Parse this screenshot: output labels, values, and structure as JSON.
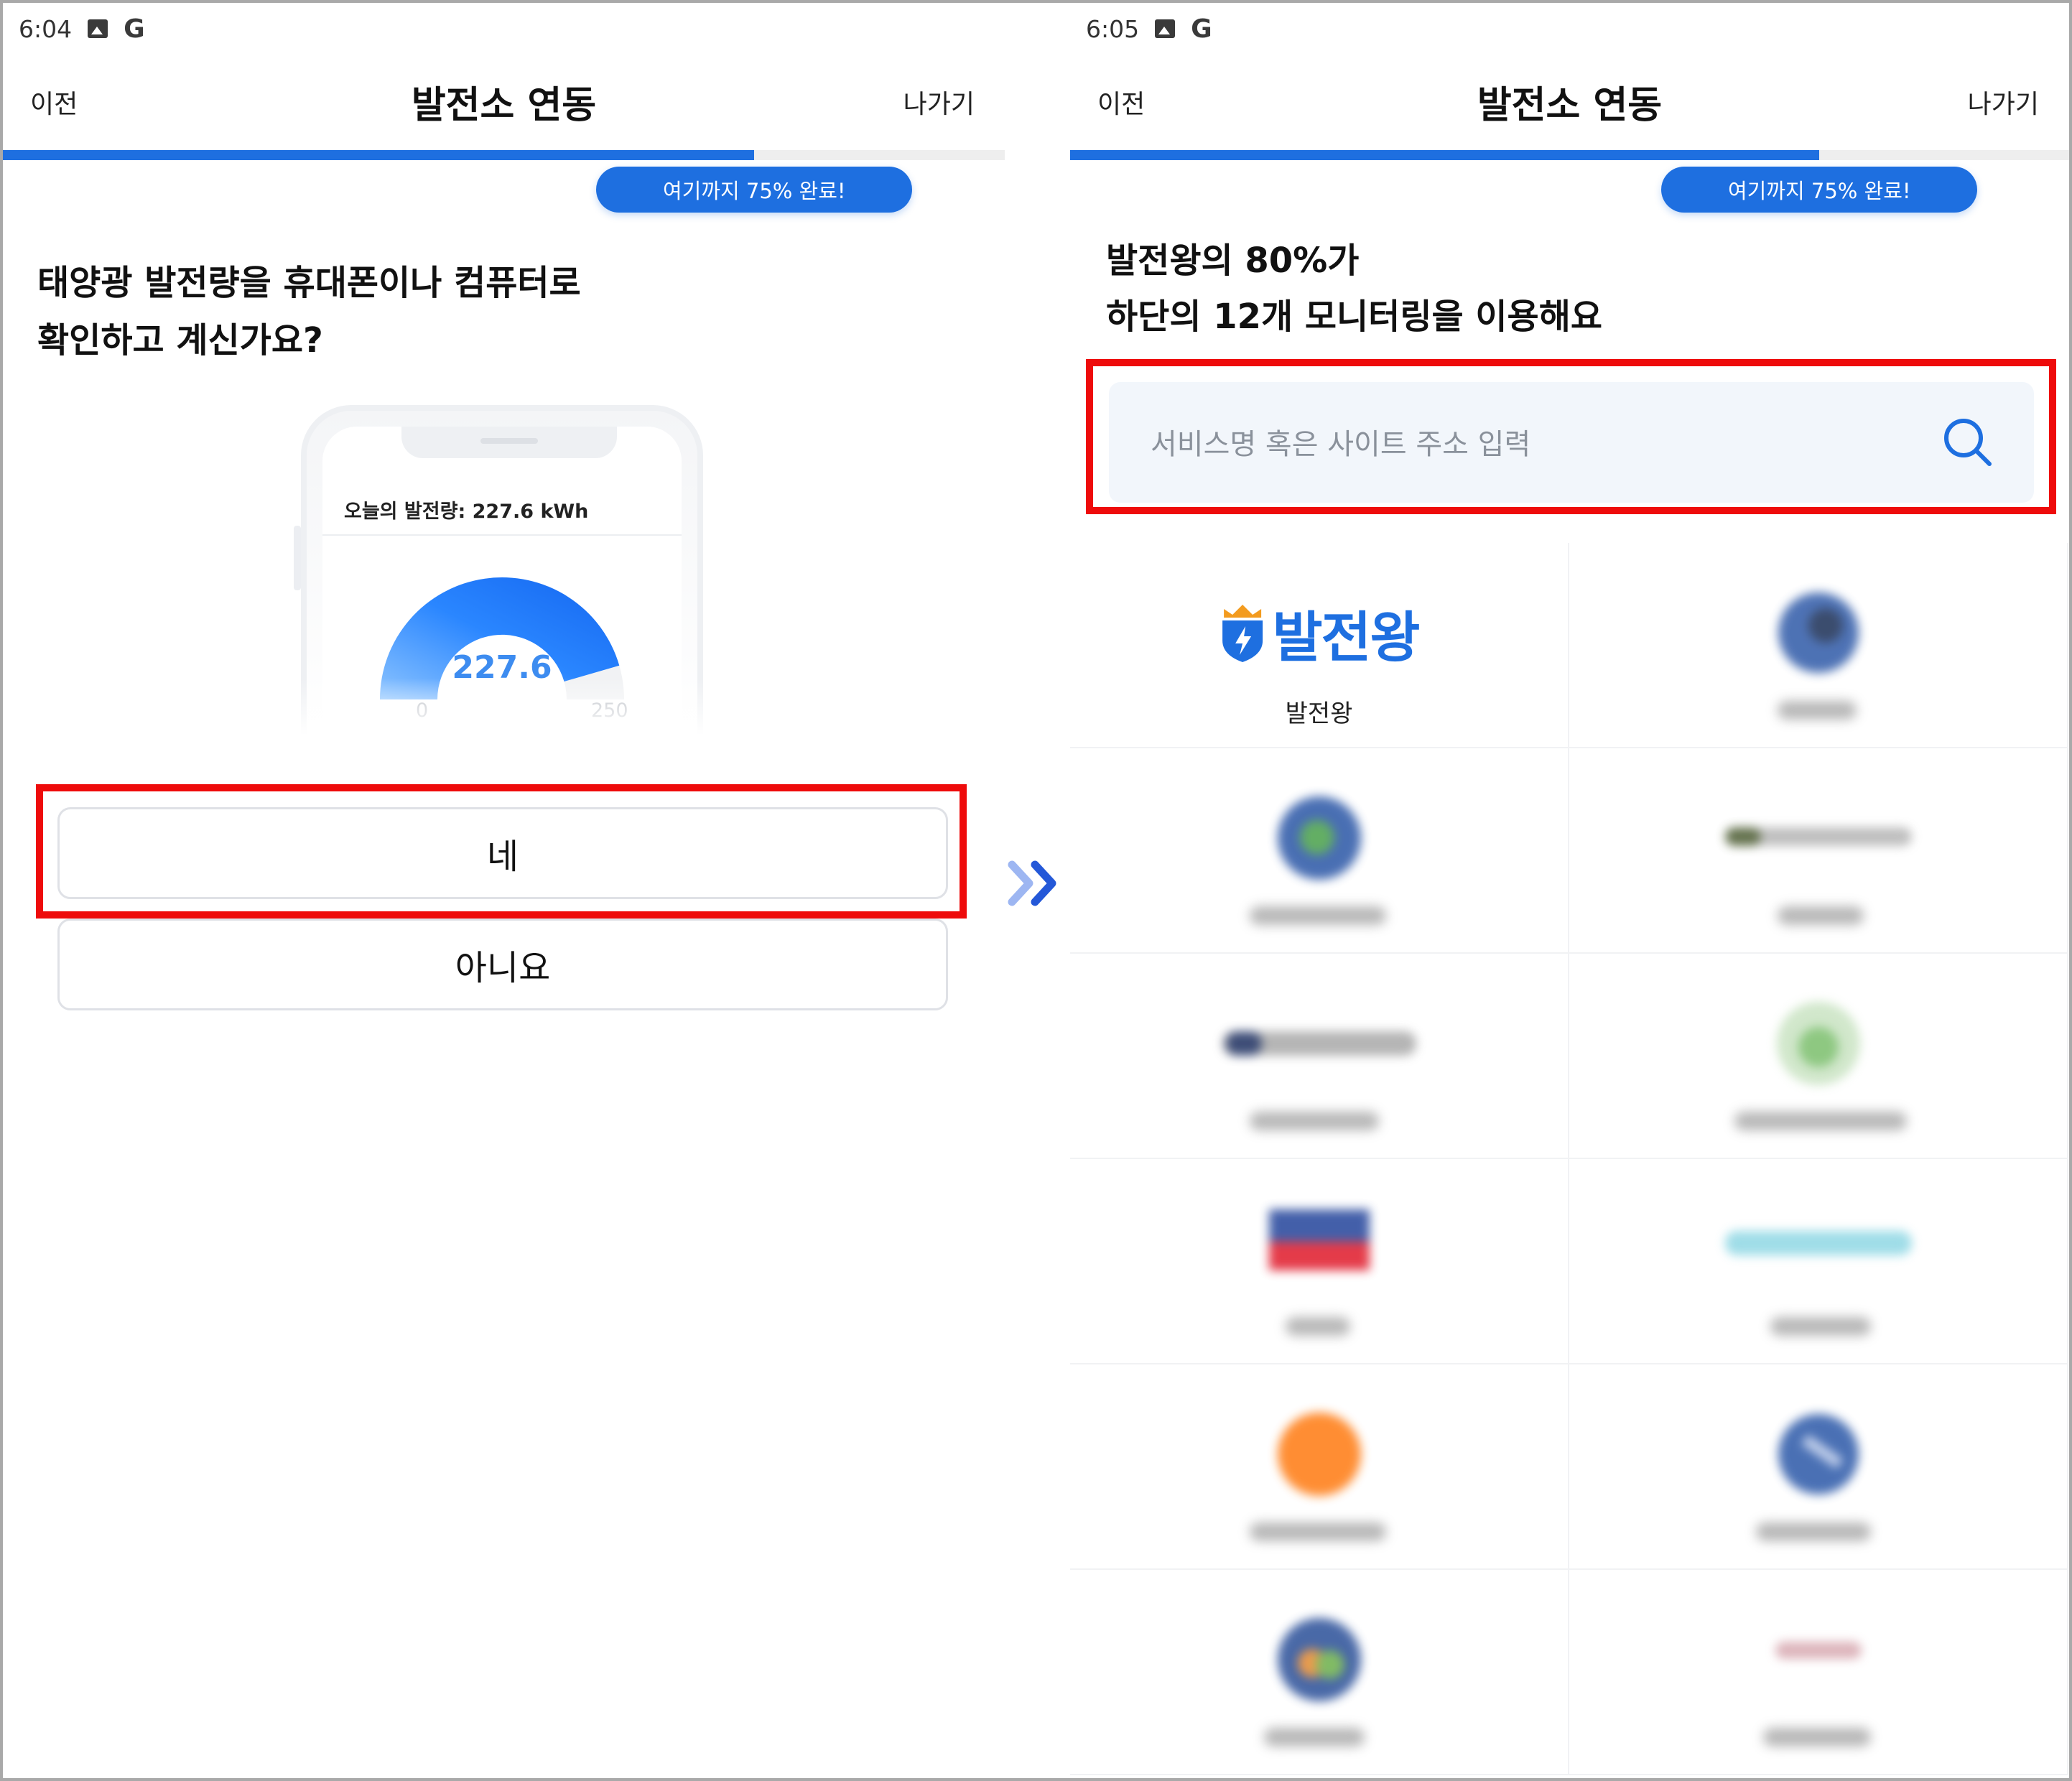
{
  "left": {
    "status": {
      "time": "6:04",
      "icons": [
        "image-icon",
        "google-icon"
      ]
    },
    "header": {
      "prev_label": "이전",
      "title": "발전소 연동",
      "exit_label": "나가기"
    },
    "progress": {
      "percent": 75,
      "badge": "여기까지 75% 완료!"
    },
    "question": {
      "line1": "태양광 발전량을 휴대폰이나 컴퓨터로",
      "line2": "확인하고 계신가요?"
    },
    "phone": {
      "readout": "오늘의 발전량: 227.6 kWh",
      "gauge_value": "227.6",
      "gauge_min": "0",
      "gauge_max": "250"
    },
    "answers": {
      "yes": "네",
      "no": "아니요"
    }
  },
  "right": {
    "status": {
      "time": "6:05",
      "icons": [
        "image-icon",
        "google-icon"
      ]
    },
    "header": {
      "prev_label": "이전",
      "title": "발전소 연동",
      "exit_label": "나가기"
    },
    "progress": {
      "percent": 75,
      "badge": "여기까지 75% 완료!"
    },
    "stat": {
      "line1": "발전왕의 80%가",
      "line2": "하단의 12개 모니터링을 이용해요"
    },
    "search": {
      "placeholder": "서비스명 혹은 사이트 주소 입력"
    },
    "services": [
      {
        "name": "발전왕",
        "logo_text": "발전왕"
      }
    ]
  },
  "colors": {
    "accent": "#1e6fe0",
    "highlight": "#ee0b0b"
  }
}
